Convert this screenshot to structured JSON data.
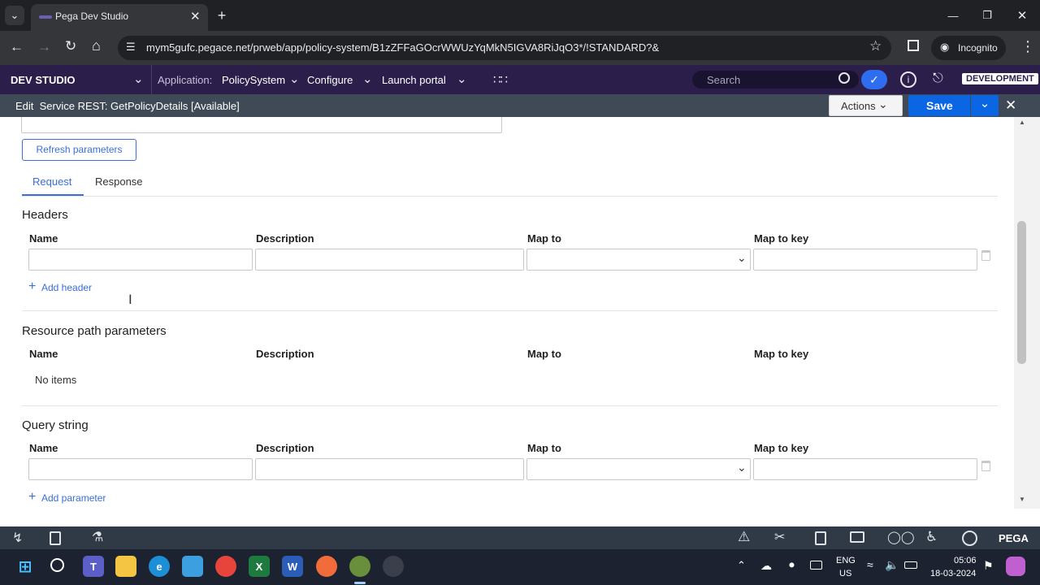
{
  "browser": {
    "tab_title": "Pega Dev Studio",
    "url": "mym5gufc.pegace.net/prweb/app/policy-system/B1zZFFaGOcrWWUzYqMkN5IGVA8RiJqO3*/!STANDARD?&",
    "incognito_label": "Incognito"
  },
  "pega_header": {
    "brand": "DEV STUDIO",
    "application_label": "Application:",
    "application_value": "PolicySystem",
    "configure": "Configure",
    "launch_portal": "Launch portal",
    "search_placeholder": "Search",
    "environment": "DEVELOPMENT"
  },
  "rule_header": {
    "title": "Edit  Service REST: GetPolicyDetails [Available]",
    "actions_label": "Actions",
    "save_label": "Save"
  },
  "content": {
    "refresh_button": "Refresh parameters",
    "tabs": [
      {
        "label": "Request",
        "active": true
      },
      {
        "label": "Response",
        "active": false
      }
    ],
    "columns": {
      "name": "Name",
      "description": "Description",
      "map_to": "Map to",
      "map_to_key": "Map to key"
    },
    "headers_section": {
      "title": "Headers",
      "add_link": "Add header"
    },
    "resource_section": {
      "title": "Resource path parameters",
      "empty_text": "No items"
    },
    "query_section": {
      "title": "Query string",
      "add_link": "Add parameter"
    }
  },
  "bottom_bar": {
    "brand": "PEGA"
  },
  "taskbar": {
    "language_line1": "ENG",
    "language_line2": "US",
    "time": "05:06",
    "date": "18-03-2024"
  },
  "colors": {
    "pega_purple": "#2b1e4a",
    "save_blue": "#0b66e4",
    "link_blue": "#3a6fd8",
    "rule_header": "#3f4a56"
  }
}
